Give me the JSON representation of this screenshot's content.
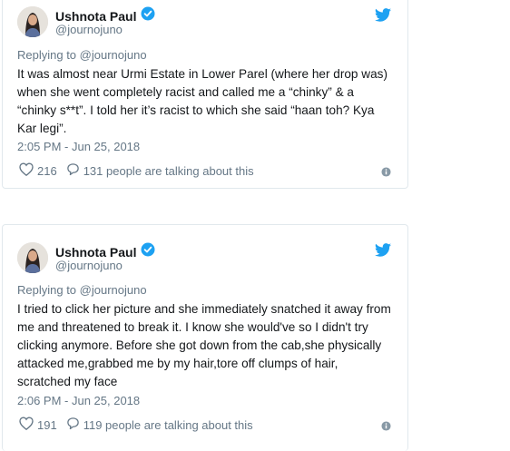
{
  "colors": {
    "twitter_blue": "#1da1f2",
    "secondary_text": "#657786",
    "primary_text": "#14171a",
    "border": "#e1e8ed"
  },
  "tweets": [
    {
      "display_name": "Ushnota Paul",
      "handle": "@journojuno",
      "verified_icon": "verified-badge-icon",
      "reply_to": "Replying to @journojuno",
      "text": "It was almost near Urmi Estate in Lower Parel (where her drop was) when she went completely racist and called me a “chinky” & a “chinky s**t”. I told her it’s racist to which she said “haan toh? Kya Kar legi”.",
      "timestamp": "2:05 PM - Jun 25, 2018",
      "likes": "216",
      "talking": "131 people are talking about this"
    },
    {
      "display_name": "Ushnota Paul",
      "handle": "@journojuno",
      "verified_icon": "verified-badge-icon",
      "reply_to": "Replying to @journojuno",
      "text": "I tried to click her picture and she immediately snatched it away from me and threatened to break it. I know she would've so I didn't try clicking anymore. Before she got down from the cab,she physically attacked me,grabbed me by my hair,tore off clumps of hair, scratched my face",
      "timestamp": "2:06 PM - Jun 25, 2018",
      "likes": "191",
      "talking": "119 people are talking about this"
    }
  ]
}
